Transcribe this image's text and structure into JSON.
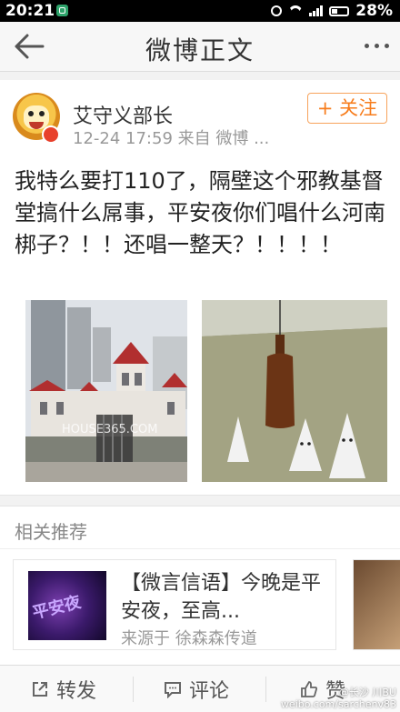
{
  "status_bar": {
    "time": "20:21",
    "battery": "28%"
  },
  "nav": {
    "title": "微博正文"
  },
  "post": {
    "username": "艾守义部长",
    "meta": "12-24 17:59 来自 微博 ...",
    "follow_label": "+ 关注",
    "text": "我特么要打110了，隔壁这个邪教基督堂搞什么屌事，平安夜你们唱什么河南梆子？！！还唱一整天？！！！！",
    "image1_watermark": "HOUSE365.COM"
  },
  "related": {
    "heading": "相关推荐",
    "item": {
      "title": "【微言信语】今晚是平安夜，至高...",
      "source": "来源于 徐森森传道",
      "thumb_text": "平安夜"
    }
  },
  "toolbar": {
    "repost": "转发",
    "comment": "评论",
    "like": "赞"
  },
  "watermark": {
    "line1": "@长沙 川BU",
    "line2": "weibo.com/sarchenv83"
  }
}
